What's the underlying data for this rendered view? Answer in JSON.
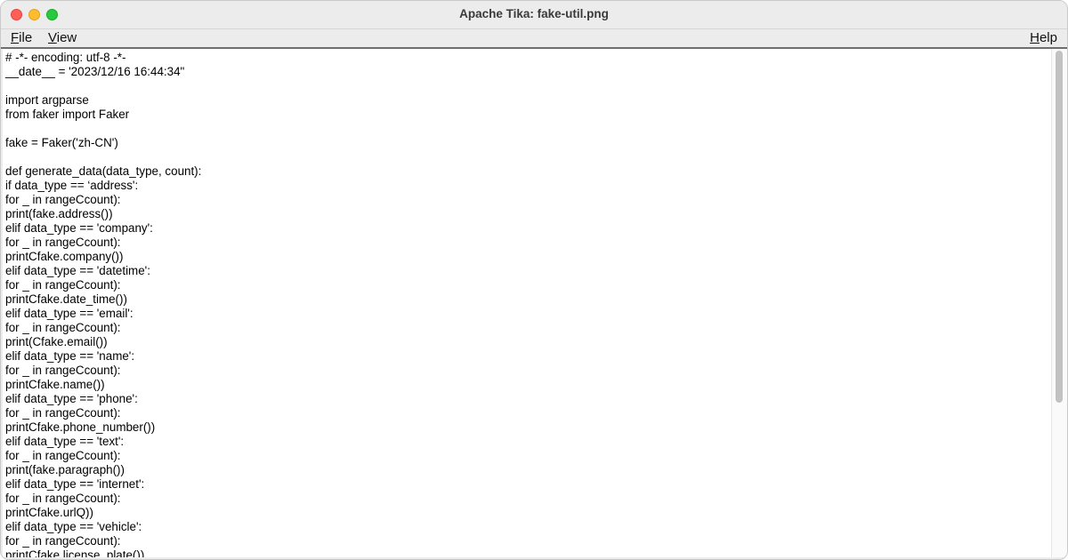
{
  "window": {
    "title": "Apache Tika: fake-util.png"
  },
  "menu": {
    "file": {
      "mnemonic": "F",
      "rest": "ile"
    },
    "view": {
      "mnemonic": "V",
      "rest": "iew"
    },
    "help": {
      "mnemonic": "H",
      "rest": "elp"
    }
  },
  "content": {
    "text": "# -*- encoding: utf-8 -*-\n__date__ = '2023/12/16 16:44:34\"\n\nimport argparse\nfrom faker import Faker\n\nfake = Faker('zh-CN')\n\ndef generate_data(data_type, count):\nif data_type == ‘address':\nfor _ in rangeCcount):\nprint(fake.address())\nelif data_type == 'company':\nfor _ in rangeCcount):\nprintCfake.company())\nelif data_type == 'datetime':\nfor _ in rangeCcount):\nprintCfake.date_time())\nelif data_type == 'email':\nfor _ in rangeCcount):\nprint(Cfake.email())\nelif data_type == 'name':\nfor _ in rangeCcount):\nprintCfake.name())\nelif data_type == 'phone':\nfor _ in rangeCcount):\nprintCfake.phone_number())\nelif data_type == 'text':\nfor _ in rangeCcount):\nprint(fake.paragraph())\nelif data_type == 'internet':\nfor _ in rangeCcount):\nprintCfake.urlQ))\nelif data_type == 'vehicle':\nfor _ in rangeCcount):\nprintCfake.license_plate())"
  },
  "colors": {
    "close": "#ff5f57",
    "minimize": "#febc2e",
    "zoom": "#28c840",
    "chrome": "#ececec"
  }
}
